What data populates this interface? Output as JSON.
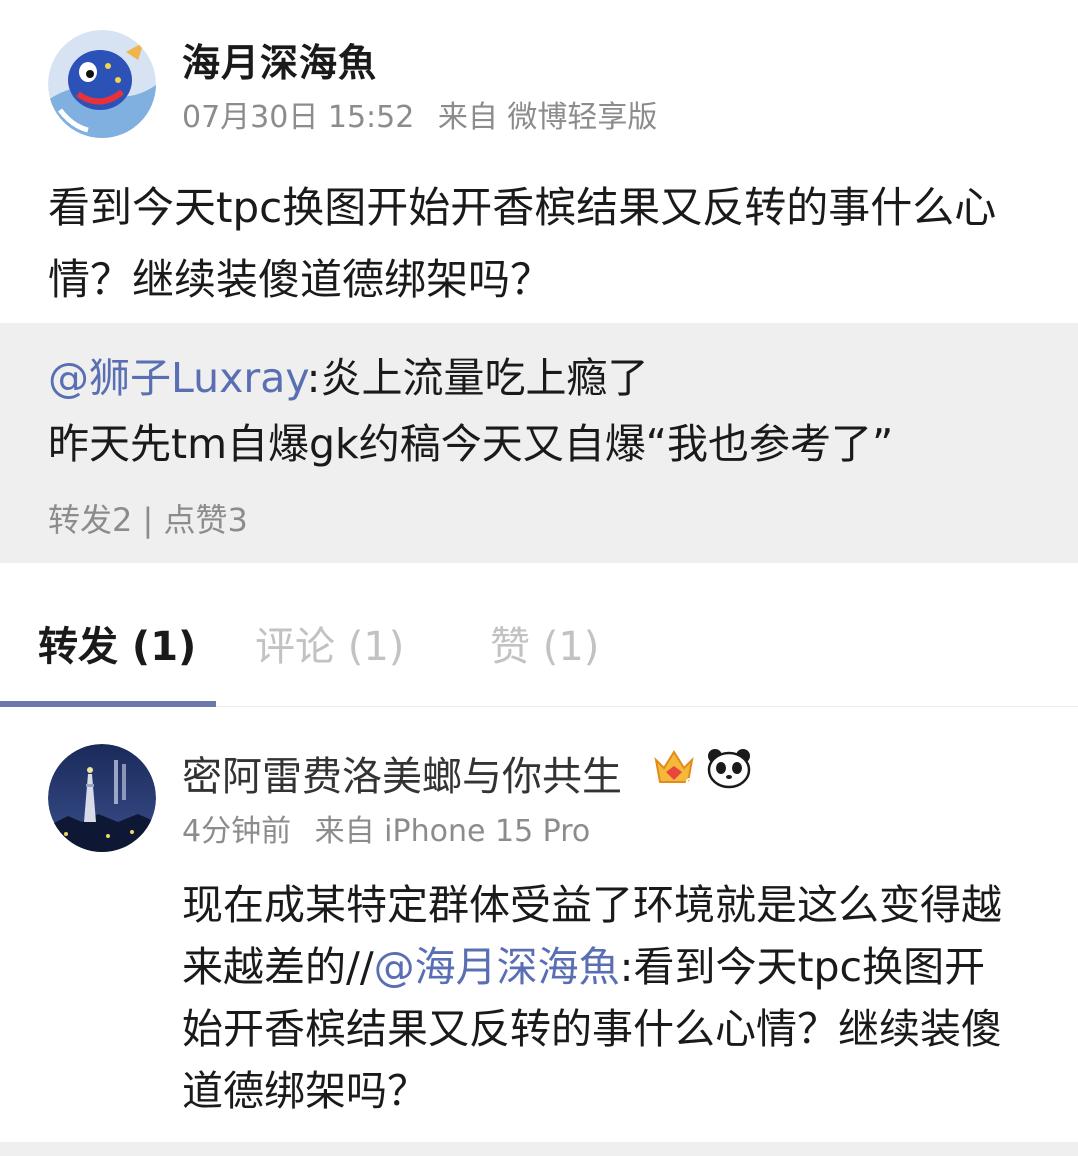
{
  "post": {
    "author": "海月深海魚",
    "date": "07月30日 15:52",
    "source": "来自 微博轻享版",
    "text": "看到今天tpc换图开始开香槟结果又反转的事什么心情？继续装傻道德绑架吗？"
  },
  "quoted": {
    "mention": "@狮子Luxray",
    "text_line1": ":炎上流量吃上瘾了",
    "text_line2": "昨天先tm自爆gk约稿今天又自爆“我也参考了”",
    "stats": "转发2 | 点赞3"
  },
  "tabs": {
    "repost": "转发 (1)",
    "comment": "评论 (1)",
    "like": "赞 (1)"
  },
  "repost": {
    "name": "密阿雷费洛美螂与你共生",
    "time": "4分钟前",
    "source": "来自 iPhone 15 Pro",
    "text_before": "现在成某特定群体受益了环境就是这么变得越来越差的//",
    "mention": "@海月深海魚",
    "text_after": ":看到今天tpc换图开始开香槟结果又反转的事什么心情？继续装傻道德绑架吗？",
    "badges": [
      "crown-badge-icon",
      "panda-badge-icon"
    ],
    "crown_level": "6"
  },
  "colors": {
    "mention": "#5a6fb3",
    "meta": "#8c8c8c",
    "tab_active_underline": "#6a78ac",
    "quoted_background": "#efefef"
  }
}
